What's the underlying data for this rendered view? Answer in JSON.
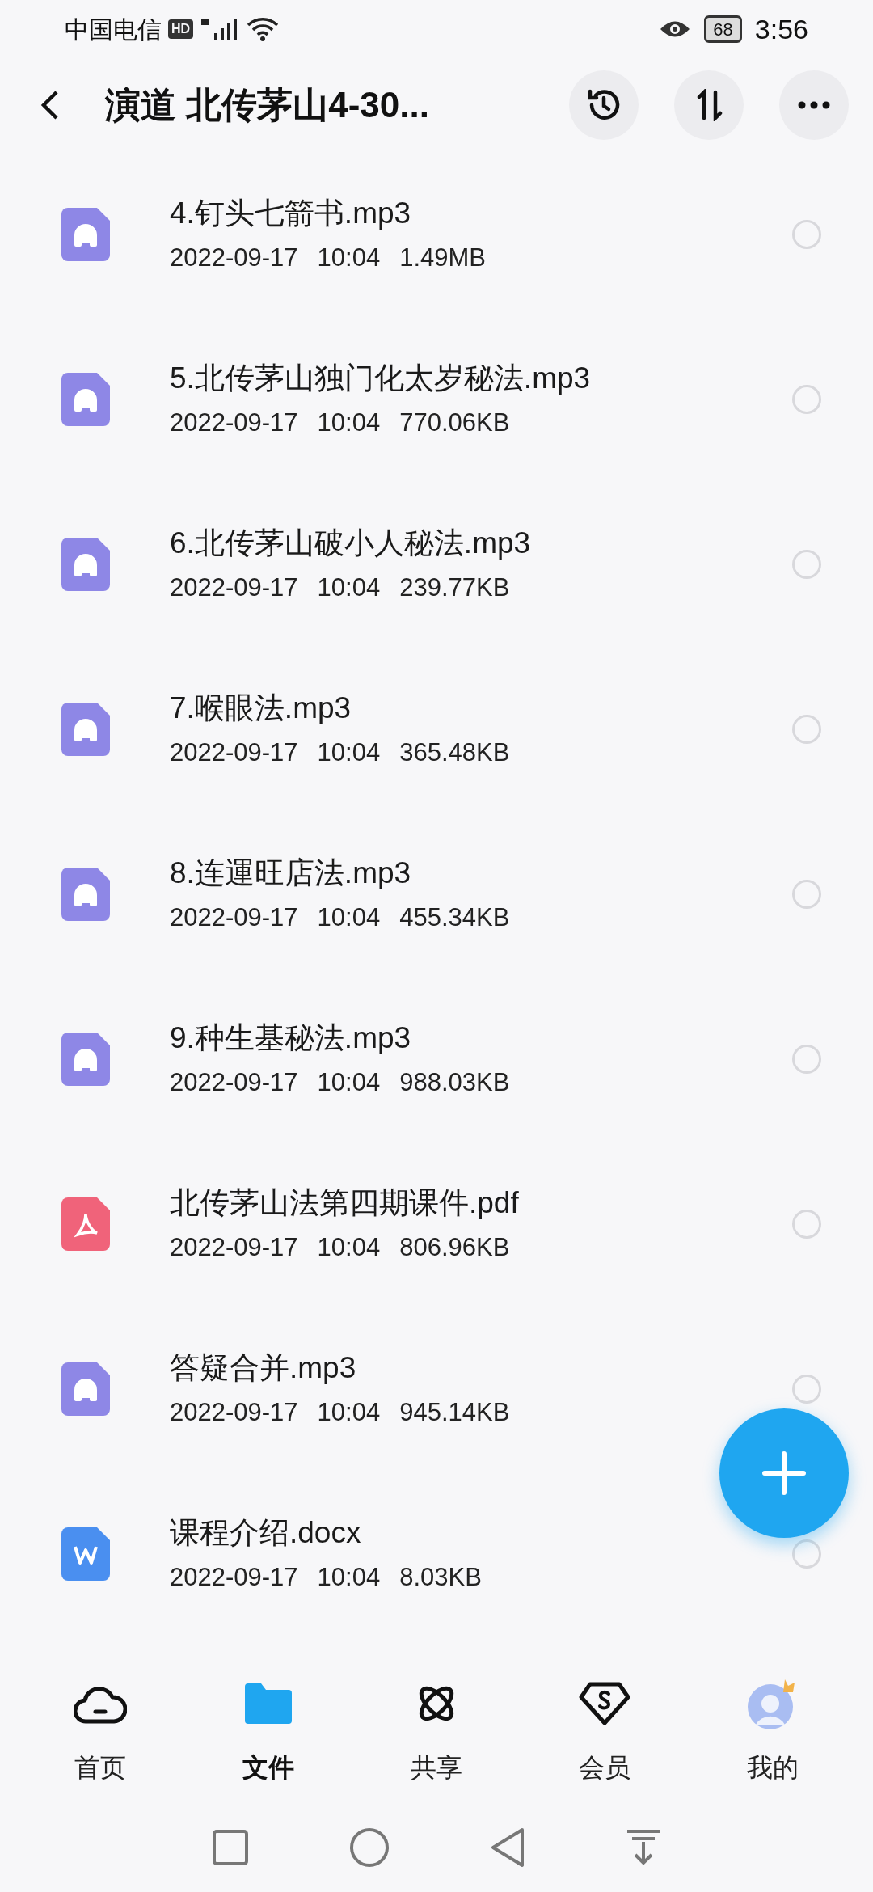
{
  "status_bar": {
    "carrier": "中国电信",
    "hd_badge": "HD",
    "battery": "68",
    "time": "3:56"
  },
  "header": {
    "title": "演道 北传茅山4-30..."
  },
  "files": [
    {
      "name": "4.钉头七箭书.mp3",
      "date": "2022-09-17",
      "time": "10:04",
      "size": "1.49MB",
      "kind": "audio",
      "selected": false
    },
    {
      "name": "5.北传茅山独门化太岁秘法.mp3",
      "date": "2022-09-17",
      "time": "10:04",
      "size": "770.06KB",
      "kind": "audio",
      "selected": false
    },
    {
      "name": "6.北传茅山破小人秘法.mp3",
      "date": "2022-09-17",
      "time": "10:04",
      "size": "239.77KB",
      "kind": "audio",
      "selected": false
    },
    {
      "name": "7.喉眼法.mp3",
      "date": "2022-09-17",
      "time": "10:04",
      "size": "365.48KB",
      "kind": "audio",
      "selected": false
    },
    {
      "name": "8.连運旺店法.mp3",
      "date": "2022-09-17",
      "time": "10:04",
      "size": "455.34KB",
      "kind": "audio",
      "selected": false
    },
    {
      "name": "9.种生基秘法.mp3",
      "date": "2022-09-17",
      "time": "10:04",
      "size": "988.03KB",
      "kind": "audio",
      "selected": false
    },
    {
      "name": "北传茅山法第四期课件.pdf",
      "date": "2022-09-17",
      "time": "10:04",
      "size": "806.96KB",
      "kind": "pdf",
      "selected": false
    },
    {
      "name": "答疑合并.mp3",
      "date": "2022-09-17",
      "time": "10:04",
      "size": "945.14KB",
      "kind": "audio",
      "selected": false
    },
    {
      "name": "课程介绍.docx",
      "date": "2022-09-17",
      "time": "10:04",
      "size": "8.03KB",
      "kind": "doc",
      "selected": false
    }
  ],
  "bottom_nav": [
    {
      "label": "首页",
      "kind": "cloud",
      "selected": false
    },
    {
      "label": "文件",
      "kind": "folder",
      "selected": true
    },
    {
      "label": "共享",
      "kind": "share",
      "selected": false
    },
    {
      "label": "会员",
      "kind": "vip",
      "selected": false
    },
    {
      "label": "我的",
      "kind": "avatar",
      "selected": false
    }
  ]
}
